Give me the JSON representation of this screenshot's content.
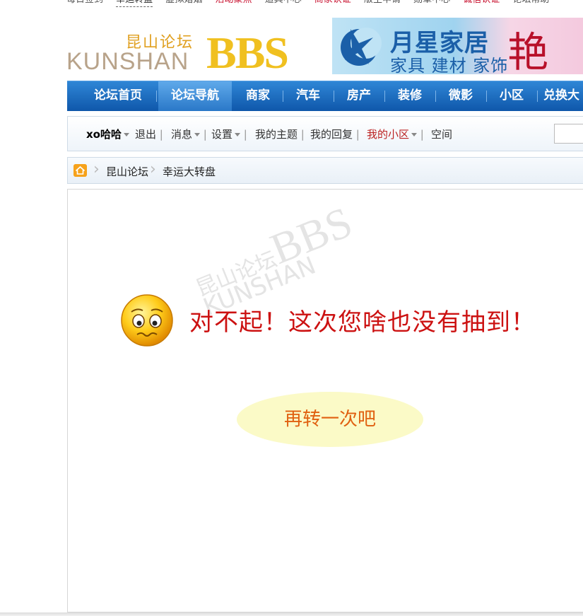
{
  "topbar": {
    "items": [
      "每日签到",
      "幸运转盘",
      "虚拟婚姻",
      "活动聚焦",
      "道具中心",
      "商家认证",
      "版主申请",
      "勋章中心",
      "诚信认证",
      "论坛帮助"
    ],
    "red_items": [
      "活动聚焦",
      "商家认证",
      "诚信认证"
    ]
  },
  "header": {
    "logo_cn": "昆山论坛",
    "logo_en": "KUNSHAN",
    "logo_bbs": "BBS",
    "banner_title": "月星家居",
    "banner_subtitle": "家具 建材 家饰",
    "banner_slogan": "艳"
  },
  "nav": {
    "items": [
      "论坛首页",
      "论坛导航",
      "商家",
      "汽车",
      "房产",
      "装修",
      "微影",
      "小区",
      "兑换大"
    ],
    "active": "论坛导航"
  },
  "userbar": {
    "username": "xo哈哈",
    "logout": "退出",
    "messages": "消息",
    "settings": "设置",
    "my_topics": "我的主题",
    "my_replies": "我的回复",
    "my_community": "我的小区",
    "space": "空间"
  },
  "breadcrumb": {
    "items": [
      "昆山论坛",
      "幸运大转盘"
    ]
  },
  "main": {
    "message": "对不起！这次您啥也没有抽到！",
    "retry_button": "再转一次吧",
    "watermark_cn": "昆山论坛",
    "watermark_en": "KUNSHAN",
    "watermark_bbs": "BBS"
  },
  "colors": {
    "nav_blue": "#1a64b8",
    "message_red": "#cc1111",
    "retry_bg": "#fbfac7",
    "retry_text": "#e06010"
  }
}
